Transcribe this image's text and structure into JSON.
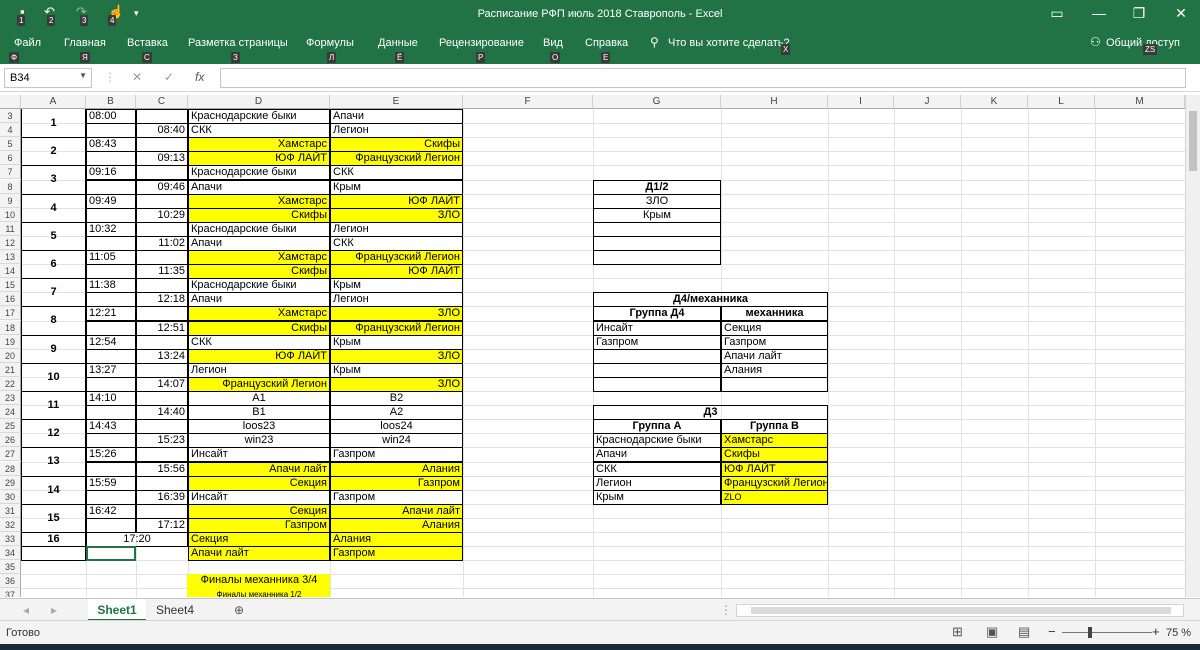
{
  "window": {
    "title": "Расписание РФП июль 2018 Ставрополь  -  Excel",
    "keytips": [
      "1",
      "2",
      "3",
      "4"
    ]
  },
  "ribbon": {
    "tabs": [
      {
        "label": "Файл",
        "key": "Ф"
      },
      {
        "label": "Главная",
        "key": "Я"
      },
      {
        "label": "Вставка",
        "key": "С"
      },
      {
        "label": "Разметка страницы",
        "key": "З"
      },
      {
        "label": "Формулы",
        "key": "Л"
      },
      {
        "label": "Данные",
        "key": "Ё"
      },
      {
        "label": "Рецензирование",
        "key": "Р"
      },
      {
        "label": "Вид",
        "key": "О"
      },
      {
        "label": "Справка",
        "key": "Е"
      }
    ],
    "tell_me": "Что вы хотите сделать?",
    "tell_me_key": "Х",
    "share": "Общий доступ",
    "share_key": "ZS"
  },
  "formula_bar": {
    "cell_ref": "B34",
    "fx": "fx",
    "value": ""
  },
  "columns": [
    "A",
    "B",
    "C",
    "D",
    "E",
    "F",
    "G",
    "H",
    "I",
    "J",
    "K",
    "L",
    "M"
  ],
  "rows": [
    "3",
    "4",
    "5",
    "6",
    "7",
    "8",
    "9",
    "10",
    "11",
    "12",
    "13",
    "14",
    "15",
    "16",
    "17",
    "18",
    "19",
    "20",
    "21",
    "22",
    "23",
    "24",
    "25",
    "26",
    "27",
    "28",
    "29",
    "30",
    "31",
    "32",
    "33",
    "34",
    "35",
    "36",
    "37"
  ],
  "schedule": [
    {
      "game": "1",
      "t1": "08:00",
      "t2": "08:40",
      "a1": "Краснодарские быки",
      "b1": "Апачи",
      "a2": "СКК",
      "b2": "Легион",
      "y": false
    },
    {
      "game": "2",
      "t1": "08:43",
      "t2": "09:13",
      "a1": "Хамстарс",
      "b1": "Скифы",
      "a2": "ЮФ ЛАЙТ",
      "b2": "Французский Легион",
      "y": true
    },
    {
      "game": "3",
      "t1": "09:16",
      "t2": "09:46",
      "a1": "Краснодарские быки",
      "b1": "СКК",
      "a2": "Апачи",
      "b2": "Крым",
      "y": false
    },
    {
      "game": "4",
      "t1": "09:49",
      "t2": "10:29",
      "a1": "Хамстарс",
      "b1": "ЮФ ЛАЙТ",
      "a2": "Скифы",
      "b2": "ЗЛО",
      "y": true
    },
    {
      "game": "5",
      "t1": "10:32",
      "t2": "11:02",
      "a1": "Краснодарские быки",
      "b1": "Легион",
      "a2": "Апачи",
      "b2": "СКК",
      "y": false
    },
    {
      "game": "6",
      "t1": "11:05",
      "t2": "11:35",
      "a1": "Хамстарс",
      "b1": "Французский Легион",
      "a2": "Скифы",
      "b2": "ЮФ ЛАЙТ",
      "y": true
    },
    {
      "game": "7",
      "t1": "11:38",
      "t2": "12:18",
      "a1": "Краснодарские быки",
      "b1": "Крым",
      "a2": "Апачи",
      "b2": "Легион",
      "y": false
    },
    {
      "game": "8",
      "t1": "12:21",
      "t2": "12:51",
      "a1": "Хамстарс",
      "b1": "ЗЛО",
      "a2": "Скифы",
      "b2": "Французский Легион",
      "y": true
    },
    {
      "game": "9",
      "t1": "12:54",
      "t2": "13:24",
      "a1": "СКК",
      "b1": "Крым",
      "a2": "ЮФ ЛАЙТ",
      "b2": "ЗЛО",
      "y": false
    },
    {
      "game": "10",
      "t1": "13:27",
      "t2": "14:07",
      "a1": "Легион",
      "b1": "Крым",
      "a2": "Французский Легион",
      "b2": "ЗЛО",
      "y": false
    },
    {
      "game": "11",
      "t1": "14:10",
      "t2": "14:40",
      "a1": "А1",
      "b1": "В2",
      "a2": "В1",
      "b2": "А2",
      "y": false
    },
    {
      "game": "12",
      "t1": "14:43",
      "t2": "15:23",
      "a1": "loos23",
      "b1": "loos24",
      "a2": "win23",
      "b2": "win24",
      "y": false
    },
    {
      "game": "13",
      "t1": "15:26",
      "t2": "15:56",
      "a1": "Инсайт",
      "b1": "Газпром",
      "a2": "Апачи лайт",
      "b2": "Алания",
      "y": false
    },
    {
      "game": "14",
      "t1": "15:59",
      "t2": "16:39",
      "a1": "Секция",
      "b1": "Газпром",
      "a2": "Инсайт",
      "b2": "Газпром",
      "y": false
    },
    {
      "game": "15",
      "t1": "16:42",
      "t2": "17:12",
      "a1": "Секция",
      "b1": "Апачи лайт",
      "a2": "Газпром",
      "b2": "Алания",
      "y": false
    }
  ],
  "row33": {
    "game": "16",
    "time": "17:20",
    "d": "Секция",
    "e": "Алания"
  },
  "row34": {
    "d": "Апачи лайт",
    "e": "Газпром"
  },
  "finals": {
    "a": "Финалы механника 3/4",
    "b": "Финалы механника 1/2"
  },
  "d12": {
    "title": "Д1/2",
    "items": [
      "ЗЛО",
      "Крым"
    ]
  },
  "d4": {
    "title": "Д4/механника",
    "col1": "Группа Д4",
    "col2": "механника",
    "c1": [
      "Инсайт",
      "Газпром",
      "",
      ""
    ],
    "c2": [
      "Секция",
      "Газпром",
      "Апачи лайт",
      "Алания"
    ]
  },
  "d3": {
    "title": "Д3",
    "col1": "Группа А",
    "col2": "Группа В",
    "c1": [
      "Краснодарские быки",
      "Апачи",
      "СКК",
      "Легион",
      "Крым"
    ],
    "c2": [
      "Хамстарс",
      "Скифы",
      "ЮФ ЛАЙТ",
      "Французский Легион",
      "ZLO"
    ]
  },
  "sheets": [
    "Sheet1",
    "Sheet4"
  ],
  "status": {
    "ready": "Готово",
    "zoom": "75 %"
  }
}
